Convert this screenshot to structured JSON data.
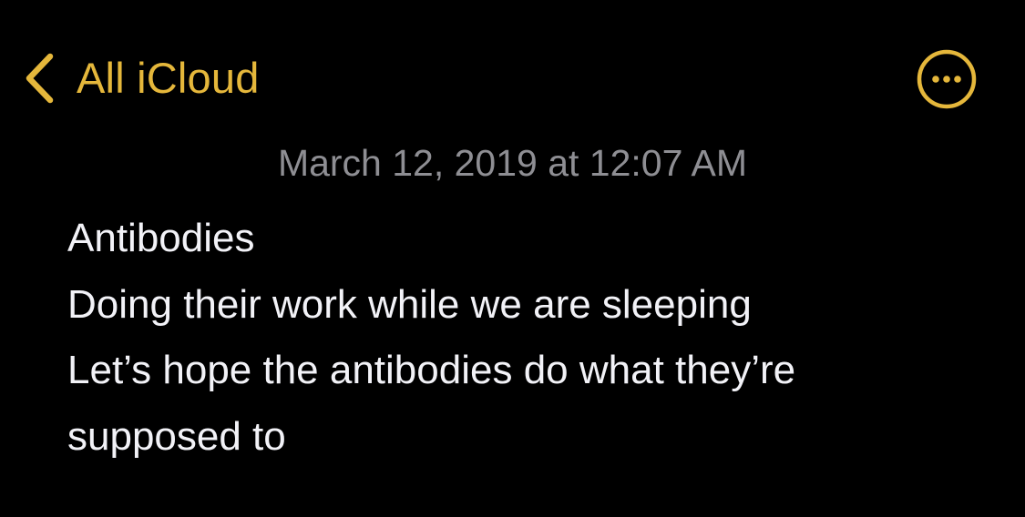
{
  "nav": {
    "back_label": "All iCloud",
    "back_icon": "chevron-left-icon",
    "more_icon": "ellipsis-circle-icon"
  },
  "note": {
    "timestamp": "March 12, 2019 at 12:07 AM",
    "lines": [
      "Antibodies",
      "Doing their work while we are sleeping",
      "Let’s hope the antibodies do what they’re",
      "supposed to"
    ]
  },
  "colors": {
    "background": "#000000",
    "accent": "#E5B73B",
    "timestamp_text": "#8E8E93",
    "body_text": "#F2F2F7"
  }
}
